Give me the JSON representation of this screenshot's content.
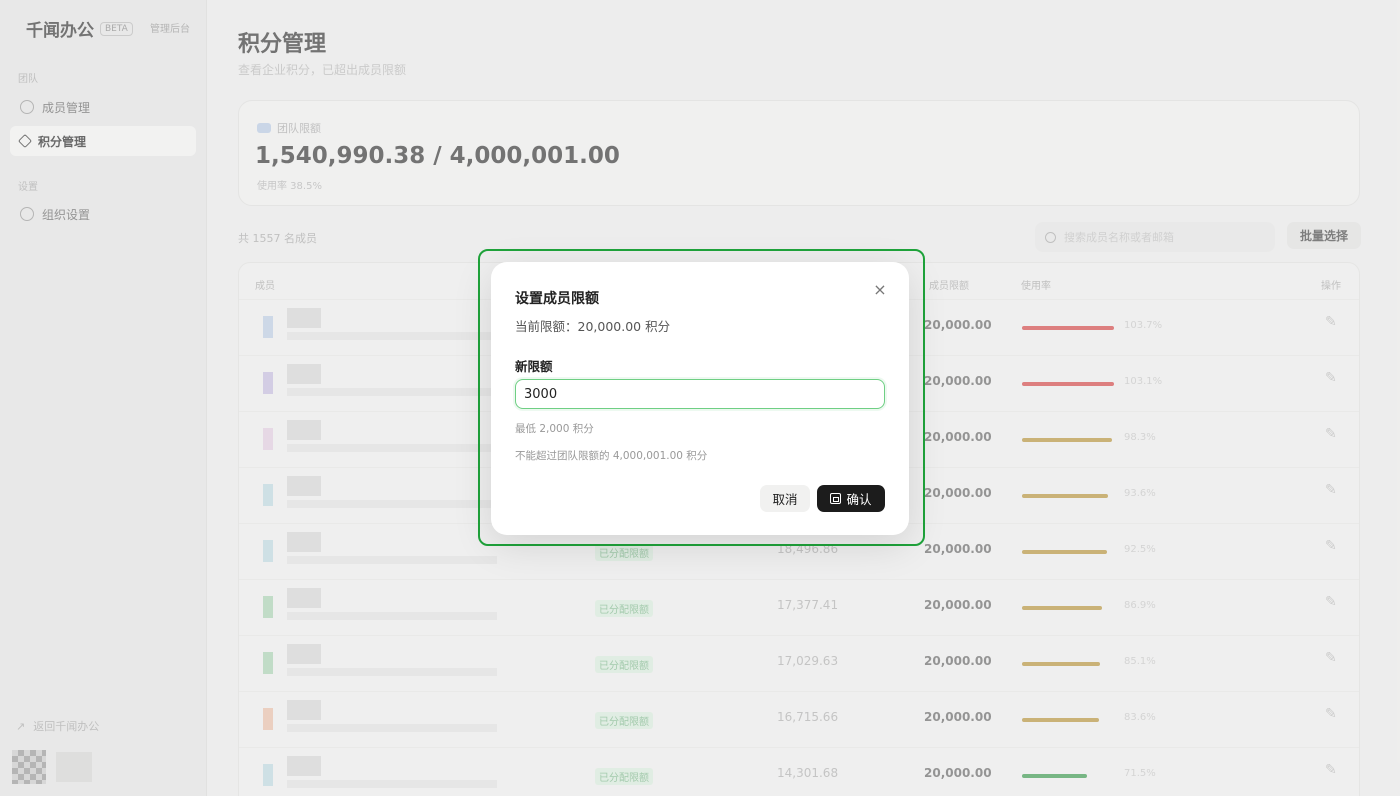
{
  "sidebar": {
    "brand_name": "千闻办公",
    "brand_tag": "BETA",
    "brand_switch": "管理后台",
    "group_1": "团队",
    "items": [
      {
        "label": "成员管理",
        "icon": "users-icon"
      },
      {
        "label": "积分管理",
        "icon": "points-icon"
      }
    ],
    "group_2": "设置",
    "settings_item": {
      "label": "组织设置",
      "icon": "settings-icon"
    },
    "footer_link": "返回千闻办公"
  },
  "page": {
    "title": "积分管理",
    "subtitle": "查看企业积分，已超出成员限额"
  },
  "stat": {
    "label": "团队限额",
    "value": "1,540,990.38 / 4,000,001.00",
    "rate": "使用率 38.5%"
  },
  "toolbar": {
    "member_count": "共 1557 名成员",
    "search_placeholder": "搜索成员名称或者邮箱",
    "batch_label": "批量选择"
  },
  "table": {
    "headers": {
      "member": "成员",
      "limit": "成员限额",
      "rate": "使用率",
      "actions": "操作"
    },
    "rows": [
      {
        "tag": "",
        "used": "",
        "limit": "20,000.00",
        "rate": "103.7%",
        "pct": 100,
        "bar_color": "#d64545",
        "swatch": "#9bb5de"
      },
      {
        "tag": "",
        "used": "",
        "limit": "20,000.00",
        "rate": "103.1%",
        "pct": 100,
        "bar_color": "#d64545",
        "swatch": "#a89bd6"
      },
      {
        "tag": "",
        "used": "",
        "limit": "20,000.00",
        "rate": "98.3%",
        "pct": 98,
        "bar_color": "#b8943a",
        "swatch": "#d9b6d8"
      },
      {
        "tag": "",
        "used": "",
        "limit": "20,000.00",
        "rate": "93.6%",
        "pct": 93,
        "bar_color": "#b8943a",
        "swatch": "#9cc9d8"
      },
      {
        "tag": "已分配限额",
        "used": "18,496.86",
        "limit": "20,000.00",
        "rate": "92.5%",
        "pct": 92,
        "bar_color": "#b8943a",
        "swatch": "#9cc9d8"
      },
      {
        "tag": "已分配限额",
        "used": "17,377.41",
        "limit": "20,000.00",
        "rate": "86.9%",
        "pct": 87,
        "bar_color": "#b8943a",
        "swatch": "#7cbf8c"
      },
      {
        "tag": "已分配限额",
        "used": "17,029.63",
        "limit": "20,000.00",
        "rate": "85.1%",
        "pct": 85,
        "bar_color": "#b8943a",
        "swatch": "#7cbf8c"
      },
      {
        "tag": "已分配限额",
        "used": "16,715.66",
        "limit": "20,000.00",
        "rate": "83.6%",
        "pct": 84,
        "bar_color": "#b8943a",
        "swatch": "#e8a07a"
      },
      {
        "tag": "已分配限额",
        "used": "14,301.68",
        "limit": "20,000.00",
        "rate": "71.5%",
        "pct": 71,
        "bar_color": "#3a9a4e",
        "swatch": "#9cc9d8"
      }
    ]
  },
  "dialog": {
    "title": "设置成员限额",
    "current_label": "当前限额：",
    "current_value": "20,000.00 积分",
    "field_label": "新限额",
    "input_value": "3000",
    "hint_min": "最低 2,000 积分",
    "hint_max": "不能超过团队限额的 4,000,001.00 积分",
    "cancel_label": "取消",
    "confirm_label": "确认",
    "close_symbol": "×"
  },
  "colors": {
    "highlight_frame": "#1fa33b",
    "input_border": "#6fcf84",
    "confirm_bg": "#1c1c1c"
  }
}
